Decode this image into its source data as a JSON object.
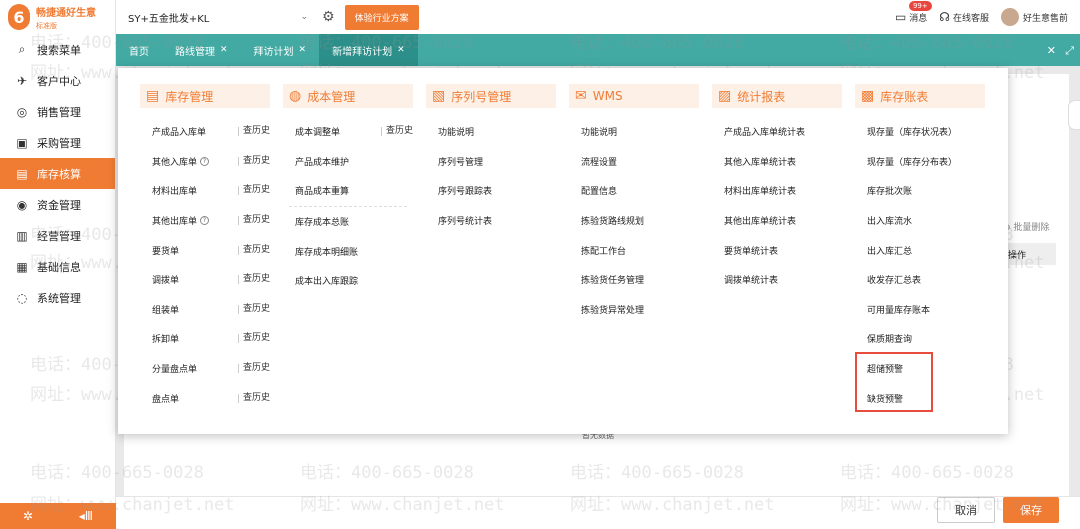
{
  "logo": {
    "name": "畅捷通好生意",
    "edition": "标准版"
  },
  "sidebar": {
    "items": [
      {
        "label": "搜索菜单",
        "icon": "search-icon"
      },
      {
        "label": "客户中心",
        "icon": "rocket-icon"
      },
      {
        "label": "销售管理",
        "icon": "sales-icon"
      },
      {
        "label": "采购管理",
        "icon": "purchase-icon"
      },
      {
        "label": "库存核算",
        "icon": "inventory-icon",
        "active": true
      },
      {
        "label": "资金管理",
        "icon": "money-icon"
      },
      {
        "label": "经营管理",
        "icon": "clipboard-icon"
      },
      {
        "label": "基础信息",
        "icon": "info-icon"
      },
      {
        "label": "系统管理",
        "icon": "system-icon"
      }
    ]
  },
  "topbar": {
    "company": "SY+五金批发+KL",
    "trial_button": "体验行业方案",
    "messages_label": "消息",
    "messages_badge": "99+",
    "service_label": "在线客服",
    "user_name": "好生意售前"
  },
  "tabs": [
    {
      "label": "首页",
      "closable": false
    },
    {
      "label": "路线管理",
      "closable": true
    },
    {
      "label": "拜访计划",
      "closable": true
    },
    {
      "label": "新增拜访计划",
      "closable": true,
      "active": true
    }
  ],
  "menu": {
    "columns": [
      {
        "title": "库存管理",
        "icon": "inventory-doc-icon",
        "items": [
          {
            "label": "产成品入库单",
            "history": "查历史"
          },
          {
            "label": "其他入库单",
            "help": true,
            "history": "查历史"
          },
          {
            "label": "材料出库单",
            "history": "查历史"
          },
          {
            "label": "其他出库单",
            "help": true,
            "history": "查历史"
          },
          {
            "label": "要货单",
            "history": "查历史"
          },
          {
            "label": "调拨单",
            "history": "查历史"
          },
          {
            "label": "组装单",
            "history": "查历史"
          },
          {
            "label": "拆卸单",
            "history": "查历史"
          },
          {
            "label": "分量盘点单",
            "history": "查历史"
          },
          {
            "label": "盘点单",
            "history": "查历史"
          }
        ]
      },
      {
        "title": "成本管理",
        "icon": "cost-icon",
        "items": [
          {
            "label": "成本调整单",
            "history": "查历史"
          },
          {
            "label": "产品成本维护"
          },
          {
            "label": "商品成本重算",
            "separator_after": true
          },
          {
            "label": "库存成本总账"
          },
          {
            "label": "库存成本明细账"
          },
          {
            "label": "成本出入库跟踪"
          }
        ]
      },
      {
        "title": "序列号管理",
        "icon": "serial-icon",
        "items": [
          {
            "label": "功能说明"
          },
          {
            "label": "序列号管理"
          },
          {
            "label": "序列号跟踪表"
          },
          {
            "label": "序列号统计表"
          }
        ]
      },
      {
        "title": "WMS",
        "icon": "wms-icon",
        "items": [
          {
            "label": "功能说明"
          },
          {
            "label": "流程设置"
          },
          {
            "label": "配置信息"
          },
          {
            "label": "拣验货路线规划"
          },
          {
            "label": "拣配工作台"
          },
          {
            "label": "拣验货任务管理"
          },
          {
            "label": "拣验货异常处理"
          }
        ]
      },
      {
        "title": "统计报表",
        "icon": "report-icon",
        "items": [
          {
            "label": "产成品入库单统计表"
          },
          {
            "label": "其他入库单统计表"
          },
          {
            "label": "材料出库单统计表"
          },
          {
            "label": "其他出库单统计表"
          },
          {
            "label": "要货单统计表"
          },
          {
            "label": "调拨单统计表"
          }
        ]
      },
      {
        "title": "库存账表",
        "icon": "ledger-icon",
        "items": [
          {
            "label": "现存量（库存状况表）"
          },
          {
            "label": "现存量（库存分布表）"
          },
          {
            "label": "库存批次账"
          },
          {
            "label": "出入库流水"
          },
          {
            "label": "出入库汇总"
          },
          {
            "label": "收发存汇总表"
          },
          {
            "label": "可用量库存账本"
          },
          {
            "label": "保质期查询"
          },
          {
            "label": "超储预警"
          },
          {
            "label": "缺货预警"
          }
        ]
      }
    ]
  },
  "background": {
    "batch_delete": "批量删除",
    "operation_header": "操作",
    "no_data": "暂无数据"
  },
  "footer": {
    "cancel": "取消",
    "save": "保存"
  },
  "watermark": {
    "phone": "电话：400-665-0028",
    "site": "网址：www.chanjet.net"
  },
  "colors": {
    "accent": "#f07c34",
    "tabbar": "#42a9a3",
    "highlight": "#e74c3c"
  }
}
